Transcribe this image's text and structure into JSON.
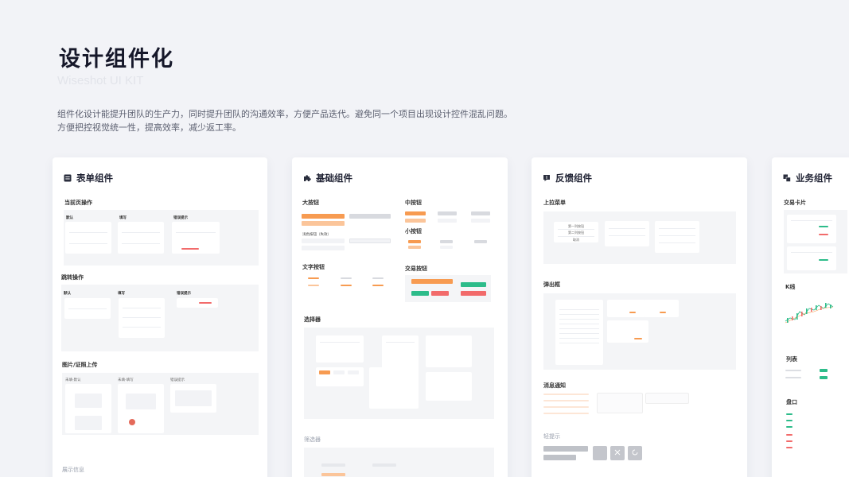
{
  "hero": {
    "title": "设计组件化",
    "subtitle": "Wiseshot UI KIT",
    "desc_line1": "组件化设计能提升团队的生产力，同时提升团队的沟通效率，方便产品迭代。避免同一个项目出现设计控件混乱问题。",
    "desc_line2": "方便把控视觉统一性，提高效率，减少返工率。"
  },
  "cards": {
    "form": {
      "title": "表单组件",
      "icon": "form-icon",
      "sections": {
        "current_page": "当前页操作",
        "jump": "跳转操作",
        "upload": "图片/证照上传",
        "display": "展示信息"
      },
      "col_labels": [
        "默认",
        "填写",
        "错误提示"
      ],
      "upload_labels": [
        "未填-默认",
        "未填-填写",
        "错误提示"
      ]
    },
    "basic": {
      "title": "基础组件",
      "icon": "puzzle-icon",
      "sections": {
        "large_button": "大按钮",
        "medium_button": "中按钮",
        "small_button": "小按钮",
        "large_button_disabled": "浅色按钮（失效）",
        "text_button": "文字按钮",
        "trade_button": "交易按钮",
        "selector": "选择器",
        "filter": "筛选器"
      }
    },
    "feedback": {
      "title": "反馈组件",
      "icon": "alert-icon",
      "sections": {
        "dropdown": "上拉菜单",
        "dialog": "弹出框",
        "notice": "消息通知",
        "toast": "轻提示"
      },
      "dropdown_items": [
        "第一列按钮",
        "第二列按钮",
        "取消"
      ]
    },
    "business": {
      "title": "业务组件",
      "icon": "layers-icon",
      "sections": {
        "trade_card": "交易卡片",
        "kline": "K线",
        "list": "列表",
        "orderbook": "盘口"
      }
    }
  },
  "colors": {
    "accent_orange": "#f79b51",
    "buy_green": "#2dbc8a",
    "sell_red": "#f26b6b",
    "title": "#16182a",
    "background": "#f2f3f7"
  }
}
